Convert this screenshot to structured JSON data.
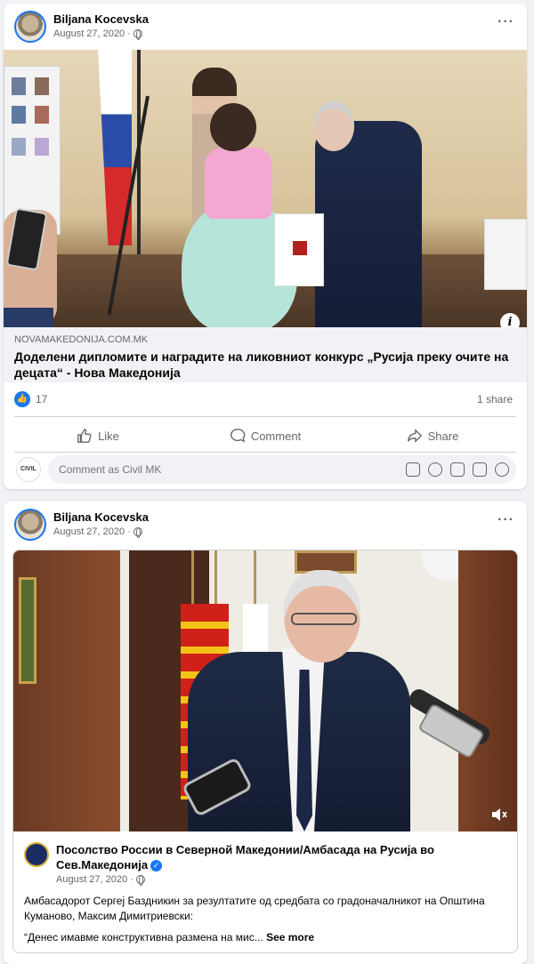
{
  "post1": {
    "author": "Biljana Kocevska",
    "date": "August 27, 2020",
    "more_label": "···",
    "link": {
      "domain": "NOVAMAKEDONIJA.COM.MK",
      "title": "Доделени дипломите и наградите на ликовниот конкурс „Русија преку очите на децата“ - Нова Македонија"
    },
    "reaction_count": "17",
    "share_count": "1 share",
    "actions": {
      "like": "Like",
      "comment": "Comment",
      "share": "Share"
    },
    "comment_placeholder": "Comment as Civil MK",
    "commenter_avatar": "CIVIL"
  },
  "post2": {
    "author": "Biljana Kocevska",
    "date": "August 27, 2020",
    "more_label": "···",
    "shared": {
      "page_name": "Посолство России в Северной Македонии/Амбасада на Русија во Сев.Македонија",
      "date": "August 27, 2020",
      "text": "Амбасадорот Сергеј Баздникин за резултатите од средбата со градоначалникот на Општина Куманово, Максим Димитриевски:",
      "text2": "“Денес имавме конструктивна размена на мис...",
      "see_more": "See more"
    }
  },
  "colors": {
    "accent": "#1877f2",
    "secondary_text": "#65676b",
    "background": "#f0f2f5"
  }
}
